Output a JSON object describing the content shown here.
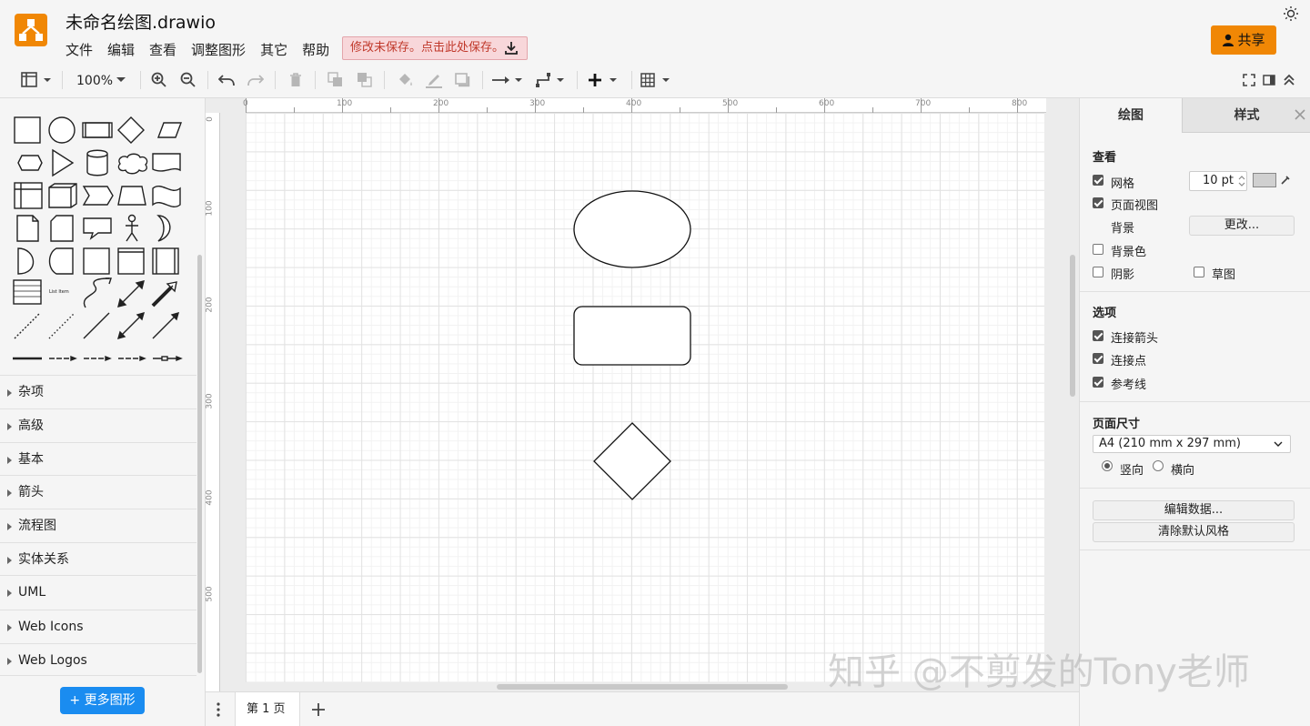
{
  "header": {
    "file_title": "未命名绘图.drawio",
    "menu": [
      "文件",
      "编辑",
      "查看",
      "调整图形",
      "其它",
      "帮助"
    ],
    "save_notice": "修改未保存。点击此处保存。",
    "share_label": "共享"
  },
  "toolbar": {
    "zoom": "100%"
  },
  "sidebar": {
    "list_item_label": "List Item",
    "categories": [
      "杂项",
      "高级",
      "基本",
      "箭头",
      "流程图",
      "实体关系",
      "UML",
      "Web Icons",
      "Web Logos"
    ],
    "more_shapes": "+ 更多图形"
  },
  "canvas": {
    "ruler_top": [
      "0",
      "100",
      "200",
      "300",
      "400",
      "500",
      "600",
      "700",
      "800"
    ],
    "ruler_left": [
      "0",
      "100",
      "200",
      "300",
      "400",
      "500"
    ],
    "page_tab": "第 1 页",
    "watermark": "知乎 @不剪发的Tony老师"
  },
  "panel": {
    "tab_diagram": "绘图",
    "tab_style": "样式",
    "view": {
      "title": "查看",
      "grid": "网格",
      "grid_size": "10 pt",
      "page_view": "页面视图",
      "background": "背景",
      "change_button": "更改...",
      "background_color": "背景色",
      "shadow": "阴影",
      "sketch": "草图"
    },
    "options": {
      "title": "选项",
      "connection_arrows": "连接箭头",
      "connection_points": "连接点",
      "guides": "参考线"
    },
    "page_size": {
      "title": "页面尺寸",
      "value": "A4 (210 mm x 297 mm)",
      "portrait": "竖向",
      "landscape": "横向"
    },
    "edit_data": "编辑数据...",
    "clear_style": "清除默认风格"
  },
  "colors": {
    "accent": "#f08705",
    "more_shapes_blue": "#1a8cf0",
    "save_notice_bg": "#f8d7da"
  }
}
